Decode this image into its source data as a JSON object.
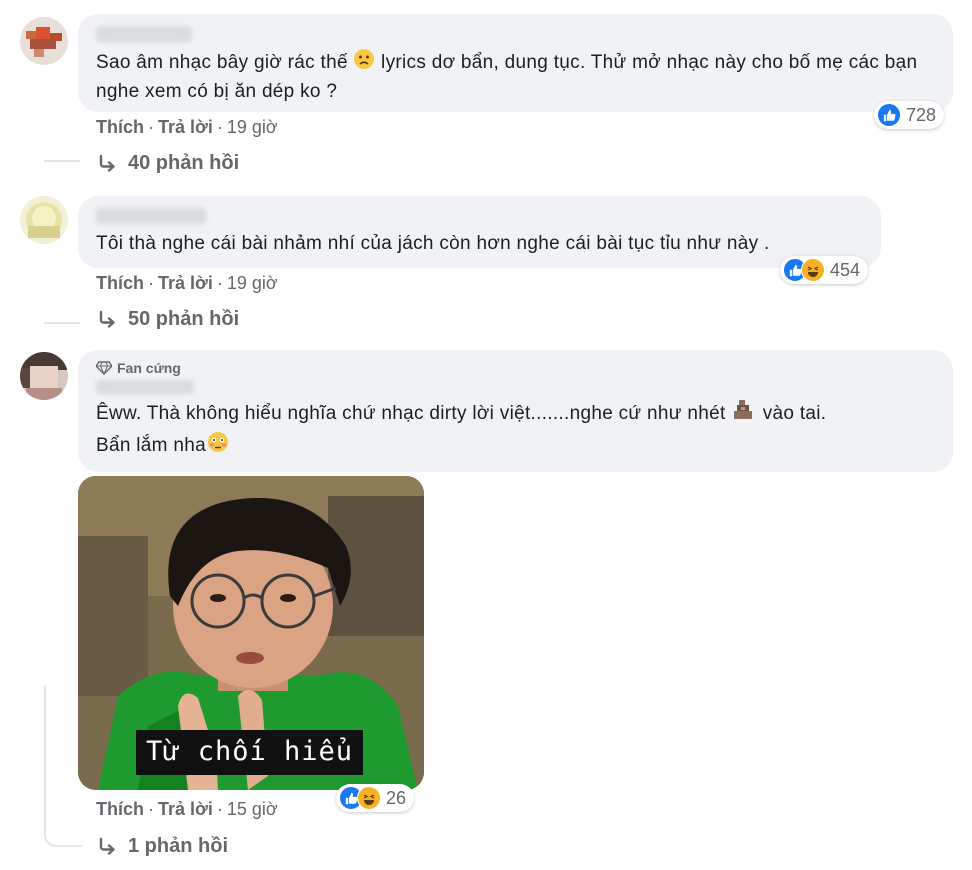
{
  "comments": [
    {
      "text": "Sao âm nhạc bây giờ rác thế 😕 lyrics dơ bẩn, dung tục. Thử mở nhạc này cho bố mẹ các bạn nghe xem có bị ăn dép ko ?",
      "text_before_emoji": "Sao âm nhạc bây giờ rác thế",
      "text_after_emoji": " lyrics dơ bẩn, dung tục. Thử mở nhạc này cho bố mẹ các bạn nghe xem có bị ăn dép ko ?",
      "like_label": "Thích",
      "reply_label": "Trả lời",
      "time": "19 giờ",
      "reaction_count": "728",
      "reactions": [
        "like"
      ],
      "replies_label": "40 phản hồi"
    },
    {
      "text": "Tôi thà nghe cái bài nhảm nhí của jách còn hơn nghe cái bài tục tỉu như này .",
      "like_label": "Thích",
      "reply_label": "Trả lời",
      "time": "19 giờ",
      "reaction_count": "454",
      "reactions": [
        "like",
        "haha"
      ],
      "replies_label": "50 phản hồi"
    },
    {
      "badge": "Fan cứng",
      "text_line1_before": "Êww. Thà không hiểu nghĩa chứ nhạc dirty lời việt.......nghe cứ như nhét ",
      "text_line1_after": " vào tai.",
      "text_line2": "Bẩn lắm nha",
      "meme_caption": "Từ chối hiểu",
      "like_label": "Thích",
      "reply_label": "Trả lời",
      "time": "15 giờ",
      "reaction_count": "26",
      "reactions": [
        "like",
        "haha"
      ],
      "replies_label": "1 phản hồi"
    }
  ],
  "colors": {
    "bubble": "#f0f2f5",
    "meta": "#65676b",
    "like_blue": "#1877f2",
    "haha_yellow": "#f7b125"
  }
}
